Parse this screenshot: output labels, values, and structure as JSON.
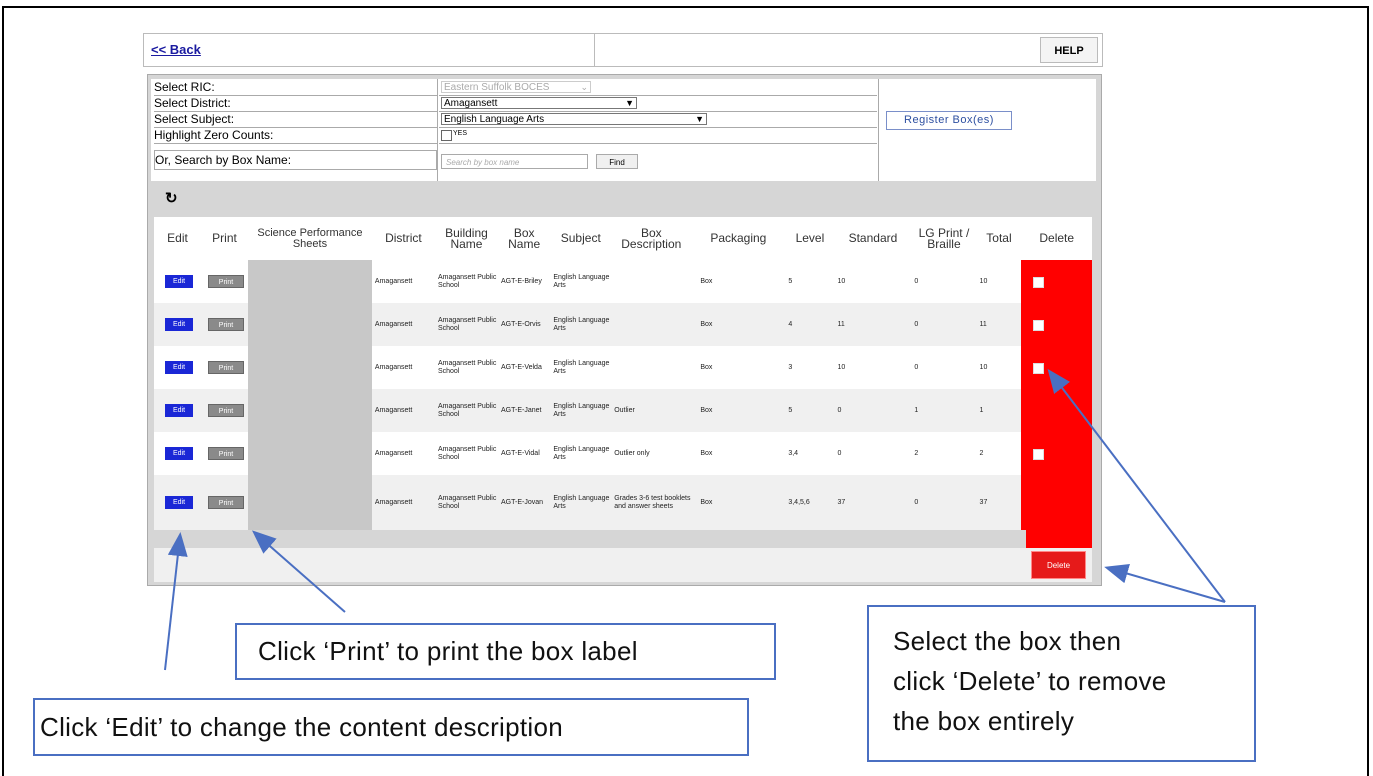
{
  "nav": {
    "back_label": "<< Back",
    "help_label": "HELP"
  },
  "form": {
    "ric_label": "Select RIC:",
    "ric_value": "Eastern Suffolk BOCES",
    "district_label": "Select District:",
    "district_value": "Amagansett",
    "subject_label": "Select Subject:",
    "subject_value": "English Language Arts",
    "highlight_label": "Highlight Zero Counts:",
    "highlight_option": "YES",
    "search_label": "Or, Search by Box Name:",
    "search_placeholder": "Search by box name",
    "find_label": "Find",
    "register_label": "Register Box(es)"
  },
  "table": {
    "headers": [
      "Edit",
      "Print",
      "Science Performance Sheets",
      "District",
      "Building Name",
      "Box Name",
      "Subject",
      "Box Description",
      "Packaging",
      "Level",
      "Standard",
      "LG Print / Braille",
      "Total",
      "Delete"
    ],
    "edit_label": "Edit",
    "print_label": "Print",
    "rows": [
      {
        "district": "Amagansett",
        "building": "Amagansett Public School",
        "box": "AGT-E-Briley",
        "subject": "English Language Arts",
        "description": "",
        "packaging": "Box",
        "level": "5",
        "standard": "10",
        "lg": "0",
        "total": "10",
        "delete_checkbox": true
      },
      {
        "district": "Amagansett",
        "building": "Amagansett Public School",
        "box": "AGT-E-Orvis",
        "subject": "English Language Arts",
        "description": "",
        "packaging": "Box",
        "level": "4",
        "standard": "11",
        "lg": "0",
        "total": "11",
        "delete_checkbox": true
      },
      {
        "district": "Amagansett",
        "building": "Amagansett Public School",
        "box": "AGT-E-Velda",
        "subject": "English Language Arts",
        "description": "",
        "packaging": "Box",
        "level": "3",
        "standard": "10",
        "lg": "0",
        "total": "10",
        "delete_checkbox": true
      },
      {
        "district": "Amagansett",
        "building": "Amagansett Public School",
        "box": "AGT-E-Janet",
        "subject": "English Language Arts",
        "description": "Outlier",
        "packaging": "Box",
        "level": "5",
        "standard": "0",
        "lg": "1",
        "total": "1",
        "delete_checkbox": false
      },
      {
        "district": "Amagansett",
        "building": "Amagansett Public School",
        "box": "AGT-E-Vidal",
        "subject": "English Language Arts",
        "description": "Outlier only",
        "packaging": "Box",
        "level": "3,4",
        "standard": "0",
        "lg": "2",
        "total": "2",
        "delete_checkbox": true
      },
      {
        "district": "Amagansett",
        "building": "Amagansett Public School",
        "box": "AGT-E-Jovan",
        "subject": "English Language Arts",
        "description": "Grades 3-6 test booklets and answer sheets",
        "packaging": "Box",
        "level": "3,4,5,6",
        "standard": "37",
        "lg": "0",
        "total": "37",
        "delete_checkbox": false
      }
    ],
    "delete_button_label": "Delete"
  },
  "callouts": {
    "print": "Click ‘Print’ to print the box label",
    "edit": "Click ‘Edit’ to change the content description",
    "delete_line1": "Select the box then",
    "delete_line2": "click ‘Delete’ to remove",
    "delete_line3": "the box entirely"
  },
  "colors": {
    "edit": "#1a27d6",
    "delete_col": "#ff0000",
    "callout_border": "#4a6fc2"
  }
}
